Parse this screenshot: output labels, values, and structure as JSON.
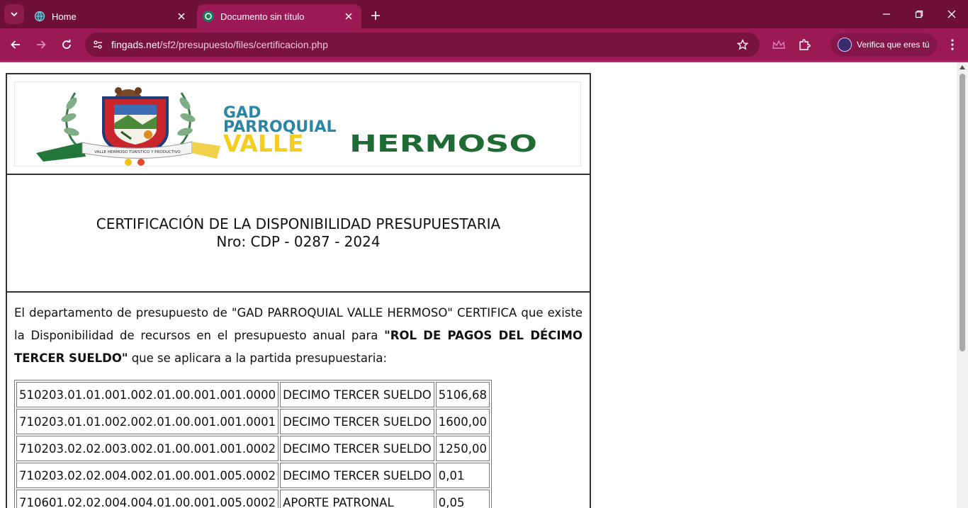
{
  "browser": {
    "tabs": [
      {
        "title": "Home",
        "active": false
      },
      {
        "title": "Documento sin título",
        "active": true
      }
    ],
    "url_host": "fingads.net",
    "url_path": "/sf2/presupuesto/files/certificacion.php",
    "profile_label": "Verifica que eres tú",
    "colors": {
      "tabstrip": "#6e1036",
      "toolbar": "#9c1a54"
    }
  },
  "document": {
    "logo": {
      "line1": "GAD",
      "line2": "PARROQUIAL",
      "line3a": "VALLE",
      "line3b": "HERMOSO",
      "ribbon": "VALLE HERMOSO TURISTICO Y PRODUCTIVO"
    },
    "heading": "CERTIFICACIÓN DE LA DISPONIBILIDAD PRESUPUESTARIA",
    "number": "Nro: CDP - 0287 - 2024",
    "para_part1": "El departamento de presupuesto de \"GAD PARROQUIAL VALLE HERMOSO\" CERTIFICA que existe la Disponibilidad de recursos en el presupuesto anual para ",
    "para_bold": "\"ROL DE PAGOS DEL DÉCIMO TERCER SUELDO\"",
    "para_part2": " que se aplicara a la partida presupuestaria:",
    "partidas": [
      {
        "codigo": "510203.01.01.001.002.01.00.001.001.0000",
        "descripcion": "DECIMO TERCER SUELDO",
        "valor": "5106,68"
      },
      {
        "codigo": "710203.01.01.002.002.01.00.001.001.0001",
        "descripcion": "DECIMO TERCER SUELDO",
        "valor": "1600,00"
      },
      {
        "codigo": "710203.02.02.003.002.01.00.001.001.0002",
        "descripcion": "DECIMO TERCER SUELDO",
        "valor": "1250,00"
      },
      {
        "codigo": "710203.02.02.004.002.01.00.001.005.0002",
        "descripcion": "DECIMO TERCER SUELDO",
        "valor": "0,01"
      },
      {
        "codigo": "710601.02.02.004.004.01.00.001.005.0002",
        "descripcion": "APORTE PATRONAL",
        "valor": "0,05"
      }
    ]
  }
}
